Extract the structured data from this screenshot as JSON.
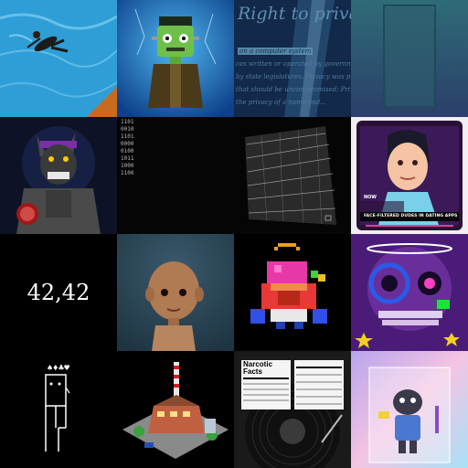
{
  "gallery": {
    "tiles": [
      {
        "id": "swimmer",
        "art": "swimmer-art"
      },
      {
        "id": "frankenstein",
        "art": "monster-art"
      },
      {
        "id": "right-to-privacy",
        "art": "text-art",
        "title": "Right to privac",
        "lines": [
          "on a computer system",
          "ces written or operated by government or oth",
          "by state legislatures. Privacy was protected",
          "that should be uncompromised; Privacy is also",
          "the privacy of a name and..."
        ]
      },
      {
        "id": "teal-frame",
        "art": "frame-art"
      },
      {
        "id": "werewolf",
        "art": "wolf-art"
      },
      {
        "id": "binary",
        "art": "binary-art",
        "lines": [
          "1101",
          "0010",
          "1101",
          "0000",
          "0100",
          "1011",
          "1000",
          "1100"
        ]
      },
      {
        "id": "mesh",
        "art": "mesh-art"
      },
      {
        "id": "dating-app",
        "art": "portrait-art",
        "badge": "NOW",
        "caption": "FACE-FILTERED DUDES IN DATING APPS"
      },
      {
        "id": "number",
        "art": "number-art",
        "text": "42,42"
      },
      {
        "id": "doll",
        "art": "doll-art"
      },
      {
        "id": "pixel-angel",
        "art": "pixel-art"
      },
      {
        "id": "neon-skull",
        "art": "skull-art"
      },
      {
        "id": "stick-figure",
        "art": "stick-art",
        "suits": "♠♦♣♥"
      },
      {
        "id": "factory",
        "art": "factory-art"
      },
      {
        "id": "vinyl",
        "art": "vinyl-art",
        "title": "Narcotic Facts"
      },
      {
        "id": "toy-figure",
        "art": "toy-art"
      }
    ]
  },
  "colors": {
    "pool": "#2f9ed6",
    "monster_bg": "#1560b8",
    "privacy_bg": "#13294a",
    "frame_bg": "#2b5e74",
    "wolf_bg": "#0d1226",
    "dark": "#050505",
    "dating_bg": "#f2eef2",
    "doll_bg": "#2d4a5c",
    "skull_bg": "#4a1c78",
    "toy_bg": "#c9b3e8"
  }
}
